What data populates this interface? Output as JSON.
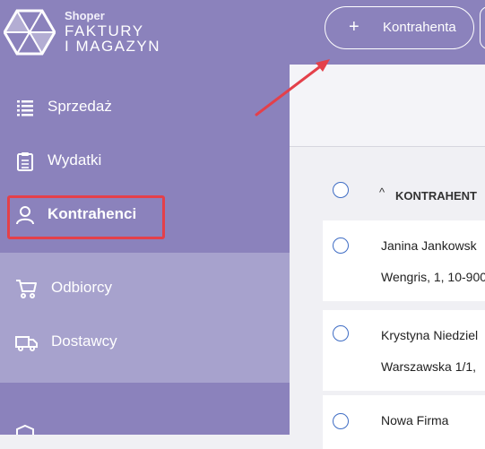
{
  "brand": {
    "small": "Shoper",
    "line1": "FAKTURY",
    "line2": "I MAGAZYN"
  },
  "sidebar": {
    "items": [
      {
        "label": "Sprzedaż",
        "icon": "list-icon"
      },
      {
        "label": "Wydatki",
        "icon": "clipboard-icon"
      },
      {
        "label": "Kontrahenci",
        "icon": "user-icon"
      }
    ],
    "subitems": [
      {
        "label": "Odbiorcy",
        "icon": "cart-icon"
      },
      {
        "label": "Dostawcy",
        "icon": "truck-icon"
      }
    ]
  },
  "toolbar": {
    "add_plus": "+",
    "add_label": "Kontrahenta"
  },
  "table": {
    "sort_arrow": "^",
    "column_header": "KONTRAHENT",
    "rows": [
      {
        "name": "Janina Jankowsk",
        "address": "Wengris, 1, 10-900"
      },
      {
        "name": "Krystyna Niedziel",
        "address": "Warszawska 1/1,"
      },
      {
        "name": "Nowa Firma",
        "address": ""
      }
    ]
  },
  "colors": {
    "sidebar": "#8b82bc",
    "submenu": "#a7a2cd",
    "highlight": "#e4404a",
    "radio": "#3e6cc4"
  }
}
